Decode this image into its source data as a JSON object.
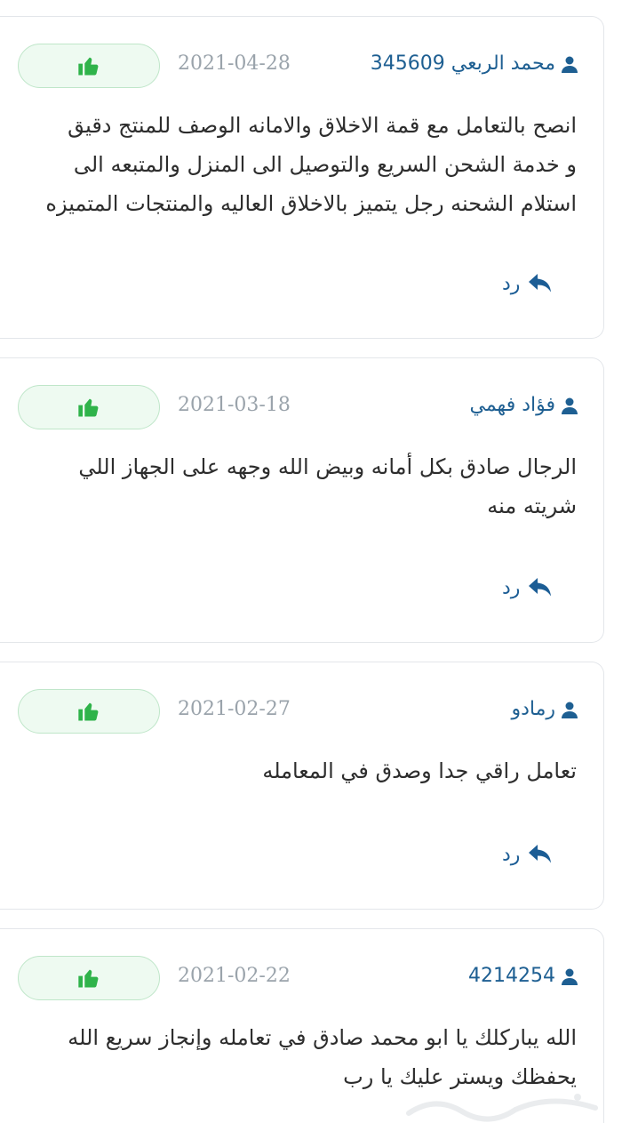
{
  "reviews": [
    {
      "author": "محمد الربعي 345609",
      "date": "2021-04-28",
      "text_lines": [
        "انصح بالتعامل مع قمة الاخلاق والامانه الوصف للمنتج دقيق",
        "و خدمة الشحن السريع والتوصيل الى المنزل والمتبعه الى",
        "استلام الشحنه رجل يتميز بالاخلاق العاليه والمنتجات المتميزه"
      ],
      "reply_label": "رد"
    },
    {
      "author": "فؤاد فهمي",
      "date": "2021-03-18",
      "text_lines": [
        "الرجال صادق بكل أمانه وبيض الله وجهه على الجهاز اللي",
        "شريته منه"
      ],
      "reply_label": "رد"
    },
    {
      "author": "رمادو",
      "date": "2021-02-27",
      "text_lines": [
        "تعامل راقي جدا وصدق في المعامله"
      ],
      "reply_label": "رد"
    },
    {
      "author": "4214254",
      "date": "2021-02-22",
      "text_lines": [
        "الله يباركلك يا ابو محمد صادق في تعامله وإنجاز سريع الله",
        "يحفظك ويستر عليك يا رب"
      ]
    }
  ],
  "icons": {
    "like": "thumbs-up-icon",
    "user": "user-icon",
    "reply": "reply-arrow-icon"
  },
  "colors": {
    "author": "#1e5f92",
    "date": "#9aa3ab",
    "like_icon": "#2fb34a",
    "like_bg": "#eefaf1",
    "reply": "#1c5d95"
  }
}
